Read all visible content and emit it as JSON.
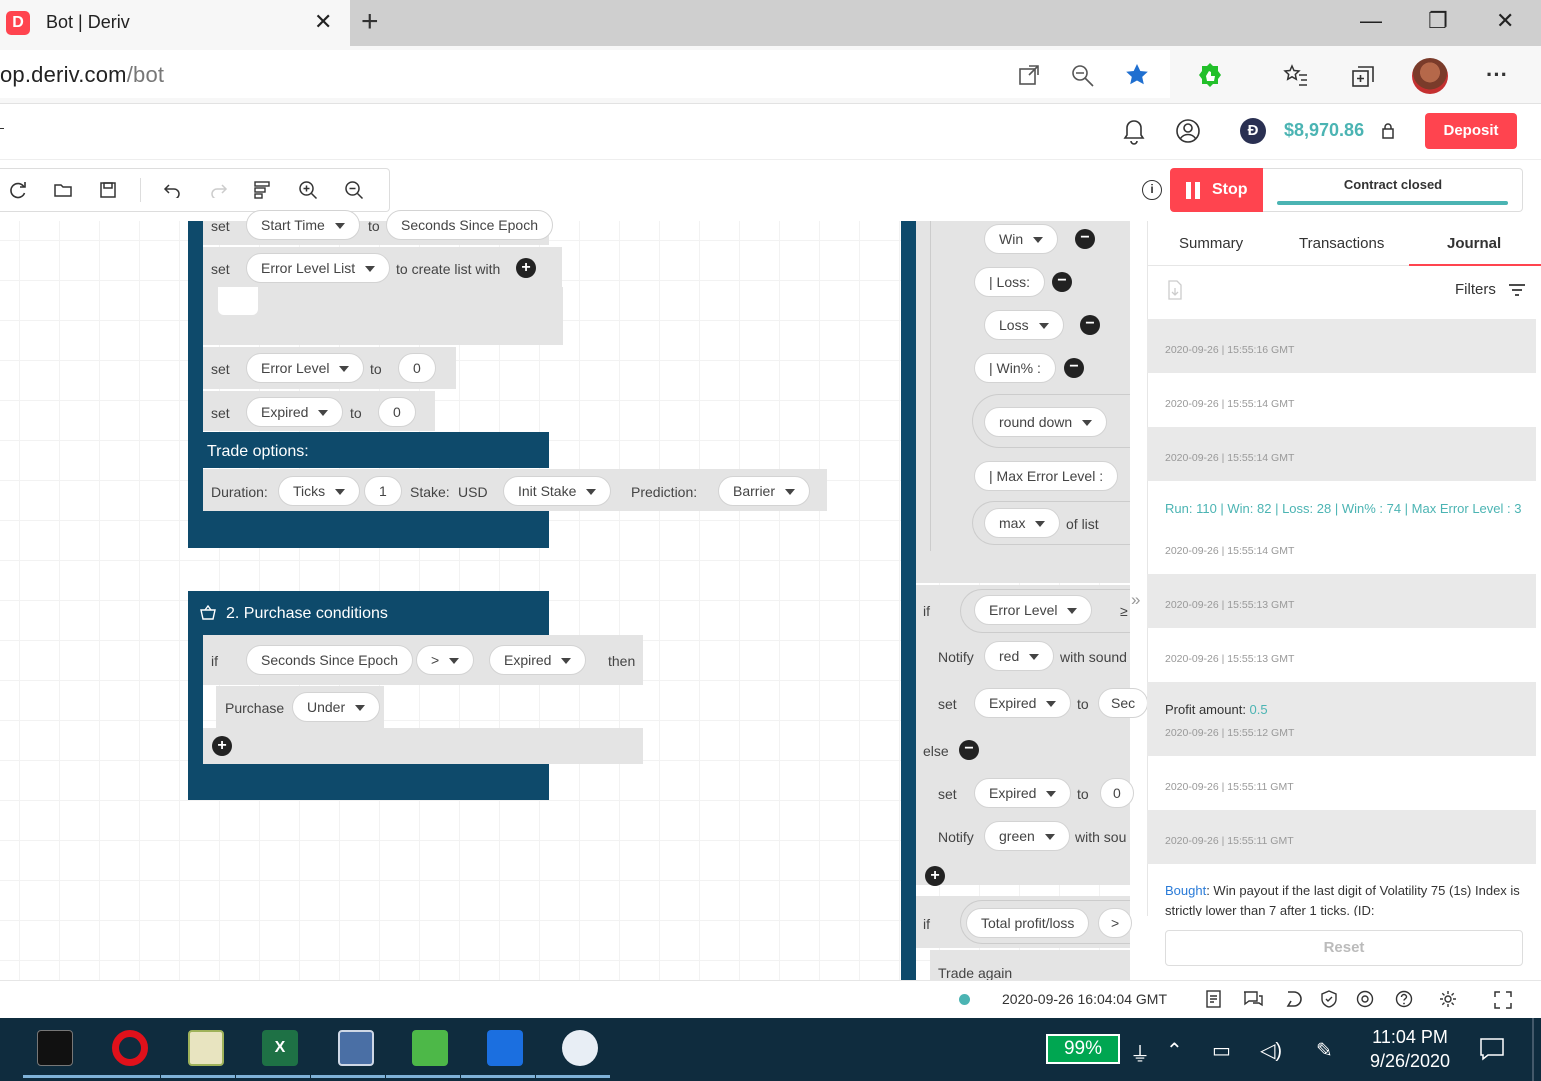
{
  "browser": {
    "tab_title": "Bot | Deriv",
    "url_host_prefix": "op.deriv.com",
    "url_path": "/bot",
    "new_tab": "+",
    "close": "✕",
    "win_min": "—",
    "win_restore": "❐",
    "win_close": "✕",
    "more": "···"
  },
  "header": {
    "balance": "$8,970.86",
    "deposit_label": "Deposit",
    "currency_symbol": "Đ"
  },
  "toolbar": {
    "stop_label": "Stop",
    "contract_status": "Contract closed"
  },
  "panel": {
    "tabs": [
      "Summary",
      "Transactions",
      "Journal"
    ],
    "active_tab": "Journal",
    "filters_label": "Filters",
    "reset_label": "Reset",
    "journal": [
      {
        "ts": "2020-09-26 | 15:55:16 GMT",
        "shade": true
      },
      {
        "ts": "2020-09-26 | 15:55:14 GMT",
        "shade": false
      },
      {
        "ts": "2020-09-26 | 15:55:14 GMT",
        "shade": true
      },
      {
        "msg": "Run: 110 | Win: 82 | Loss: 28 | Win% : 74 | Max Error Level : 3",
        "ts": "2020-09-26 | 15:55:14 GMT",
        "shade": false
      },
      {
        "ts": "2020-09-26 | 15:55:13 GMT",
        "shade": true
      },
      {
        "ts": "2020-09-26 | 15:55:13 GMT",
        "shade": false
      },
      {
        "msg_label": "Profit amount: ",
        "msg_value": "0.5",
        "ts": "2020-09-26 | 15:55:12 GMT",
        "shade": true
      },
      {
        "ts": "2020-09-26 | 15:55:11 GMT",
        "shade": false
      },
      {
        "ts": "2020-09-26 | 15:55:11 GMT",
        "shade": true
      },
      {
        "msg_link": "Bought",
        "msg_rest": ": Win payout if the last digit of Volatility 75 (1s) Index is strictly lower than 7 after 1 ticks. (ID:",
        "shade": false
      }
    ]
  },
  "blocks": {
    "set": "set",
    "to": "to",
    "start_time": "Start Time",
    "seconds_since_epoch": "Seconds Since Epoch",
    "error_level_list": "Error Level List",
    "to_create_list_with": "to create list with",
    "error_level": "Error Level",
    "zero": "0",
    "expired": "Expired",
    "trade_options": "Trade options:",
    "duration_label": "Duration:",
    "ticks": "Ticks",
    "one": "1",
    "stake_label": "Stake:",
    "usd": "USD",
    "init_stake": "Init Stake",
    "prediction_label": "Prediction:",
    "barrier": "Barrier",
    "purchase_conditions": "2. Purchase conditions",
    "if": "if",
    "gt": ">",
    "then": "then",
    "purchase": "Purchase",
    "under": "Under",
    "win": "Win",
    "loss_text": "| Loss:",
    "loss": "Loss",
    "winpct_text": "| Win% :",
    "round_down": "round down",
    "max_error_text": "| Max Error Level :",
    "max": "max",
    "of_list": "of list",
    "gte": "≥",
    "notify": "Notify",
    "red": "red",
    "with_sound": "with sound",
    "sec_trunc": "Sec",
    "else": "else",
    "zero_trunc": "0",
    "green": "green",
    "with_sou": "with sou",
    "total_profit": "Total profit/loss",
    "trade_again": "Trade again",
    "collapse": "»"
  },
  "footer": {
    "server_time": "2020-09-26 16:04:04 GMT"
  },
  "taskbar": {
    "battery": "99%",
    "time": "11:04 PM",
    "date": "9/26/2020"
  },
  "colors": {
    "brand_red": "#ff444f",
    "teal": "#4bb4b3",
    "block_navy": "#0e4a6b"
  }
}
